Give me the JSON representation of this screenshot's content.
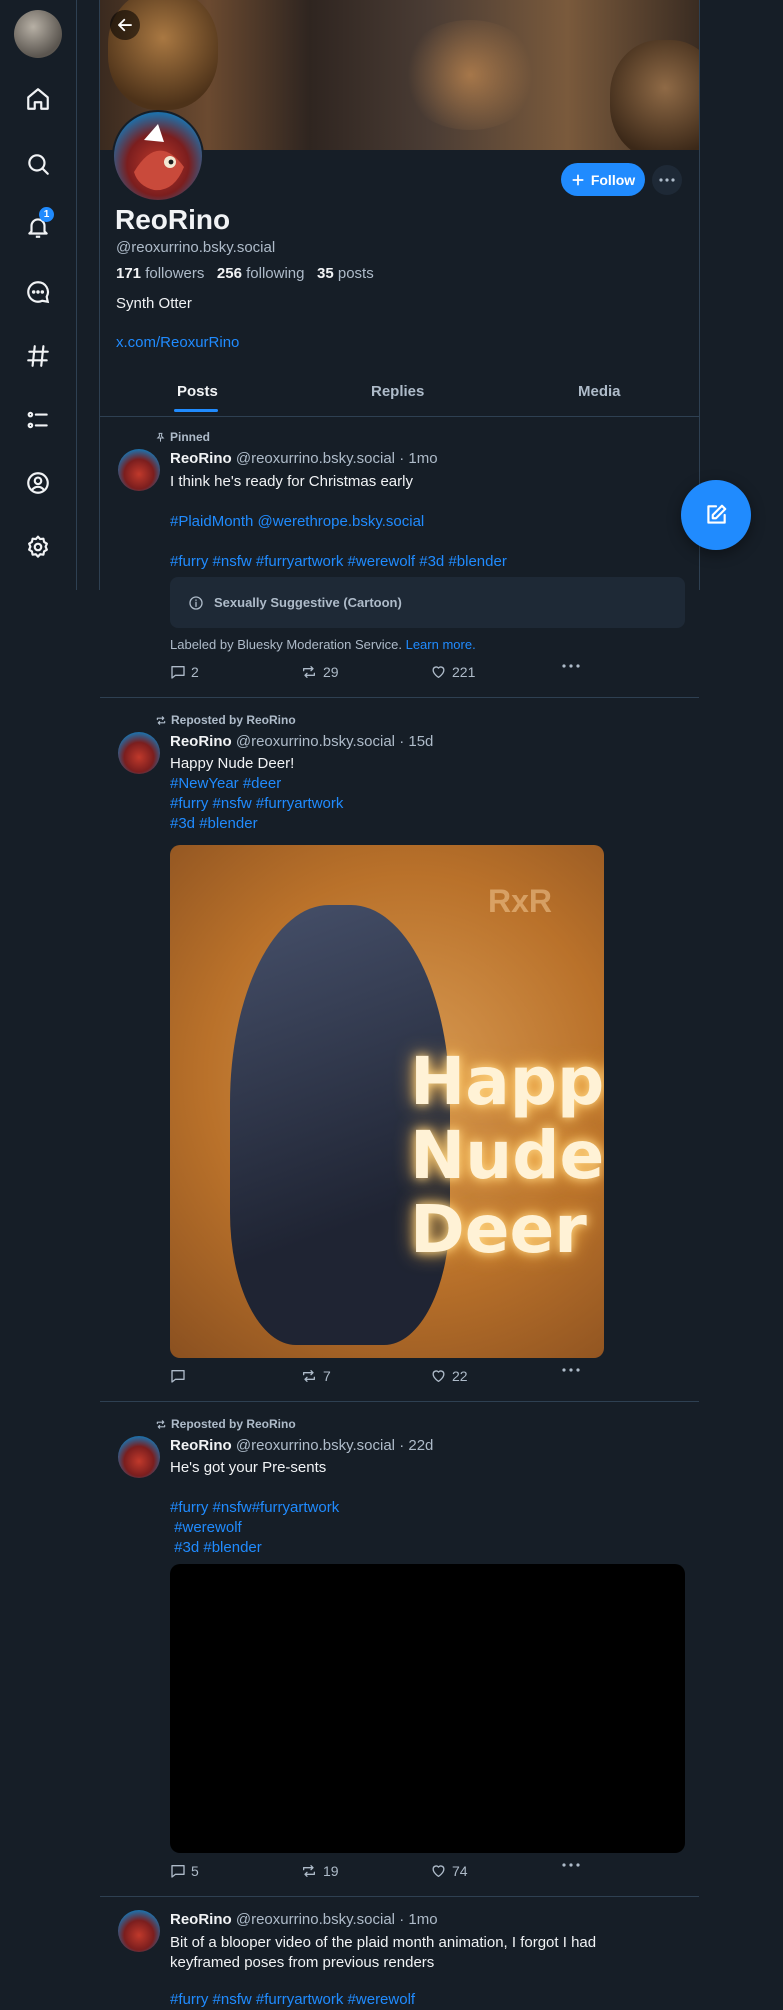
{
  "nav": {
    "notification_count": "1",
    "items": [
      "home-icon",
      "search-icon",
      "bell-icon",
      "chat-icon",
      "hashtag-icon",
      "list-icon",
      "profile-icon",
      "settings-icon"
    ]
  },
  "profile": {
    "name": "ReoRino",
    "handle": "@reoxurrino.bsky.social",
    "followers_count": "171",
    "followers_label": "followers",
    "following_count": "256",
    "following_label": "following",
    "posts_count": "35",
    "posts_label": "posts",
    "bio": "Synth Otter",
    "link": "x.com/ReoxurRino",
    "follow_label": "Follow"
  },
  "tabs": [
    "Posts",
    "Replies",
    "Media"
  ],
  "posts": [
    {
      "context": "Pinned",
      "author": "ReoRino",
      "handle": "@reoxurrino.bsky.social",
      "time": "· 1mo",
      "lines": [
        "I think he's ready for Christmas early",
        "#PlaidMonth  @werethrope.bsky.social",
        "#furry #nsfw #furryartwork #werewolf #3d #blender"
      ],
      "label": "Sexually Suggestive (Cartoon)",
      "label_note": "Labeled by Bluesky Moderation Service.",
      "label_note_link": "Learn more.",
      "replies": "2",
      "reposts": "29",
      "likes": "221"
    },
    {
      "context": "Reposted by ReoRino",
      "author": "ReoRino",
      "handle": "@reoxurrino.bsky.social",
      "time": "· 15d",
      "lines": [
        "Happy Nude Deer!",
        "#NewYear #deer",
        "#furry #nsfw #furryartwork",
        "#3d #blender"
      ],
      "image_text": [
        "Happy",
        "Nude",
        "Deer"
      ],
      "image_watermark": "RxR",
      "replies": "",
      "reposts": "7",
      "likes": "22"
    },
    {
      "context": "Reposted by ReoRino",
      "author": "ReoRino",
      "handle": "@reoxurrino.bsky.social",
      "time": "· 22d",
      "lines": [
        "He's got your Pre-sents",
        "#furry #nsfw#furryartwork",
        " #werewolf",
        " #3d #blender"
      ],
      "replies": "5",
      "reposts": "19",
      "likes": "74"
    },
    {
      "author": "ReoRino",
      "handle": "@reoxurrino.bsky.social",
      "time": "· 1mo",
      "lines": [
        "Bit of a blooper video of the plaid month animation, I forgot I had",
        "keyframed poses from previous renders",
        "#furry #nsfw #furryartwork #werewolf"
      ]
    }
  ],
  "colors": {
    "accent": "#208bfe",
    "background": "#161e27",
    "muted": "#aebbc9",
    "border": "#2e4052"
  }
}
